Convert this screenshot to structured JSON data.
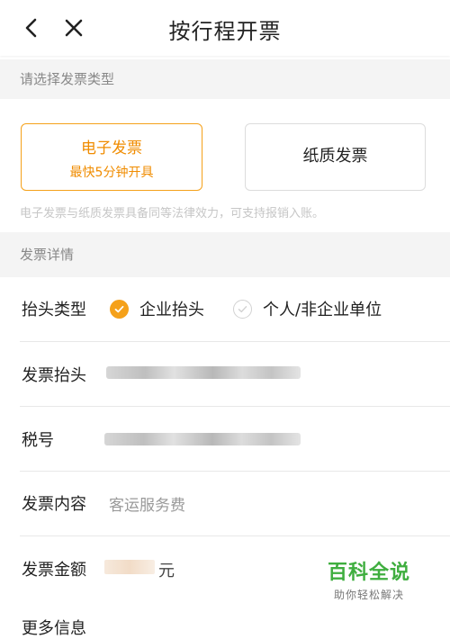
{
  "header": {
    "title": "按行程开票",
    "back_icon": "chevron-left-icon",
    "close_icon": "close-icon"
  },
  "invoice_type_section": {
    "heading": "请选择发票类型",
    "options": [
      {
        "label": "电子发票",
        "subtitle": "最快5分钟开具",
        "selected": true
      },
      {
        "label": "纸质发票",
        "selected": false
      }
    ],
    "note": "电子发票与纸质发票具备同等法律效力，可支持报销入账。",
    "accent_color": "#f5a11a"
  },
  "details_section": {
    "heading": "发票详情",
    "title_type": {
      "label": "抬头类型",
      "options": [
        {
          "label": "企业抬头",
          "selected": true
        },
        {
          "label": "个人/非企业单位",
          "selected": false
        }
      ]
    },
    "invoice_title": {
      "label": "发票抬头"
    },
    "tax_number": {
      "label": "税号"
    },
    "content": {
      "label": "发票内容",
      "value": "客运服务费"
    },
    "amount": {
      "label": "发票金额",
      "unit": "元"
    },
    "more_info": {
      "label": "更多信息"
    }
  },
  "watermark": {
    "main": "百科全说",
    "sub": "助你轻松解决"
  }
}
